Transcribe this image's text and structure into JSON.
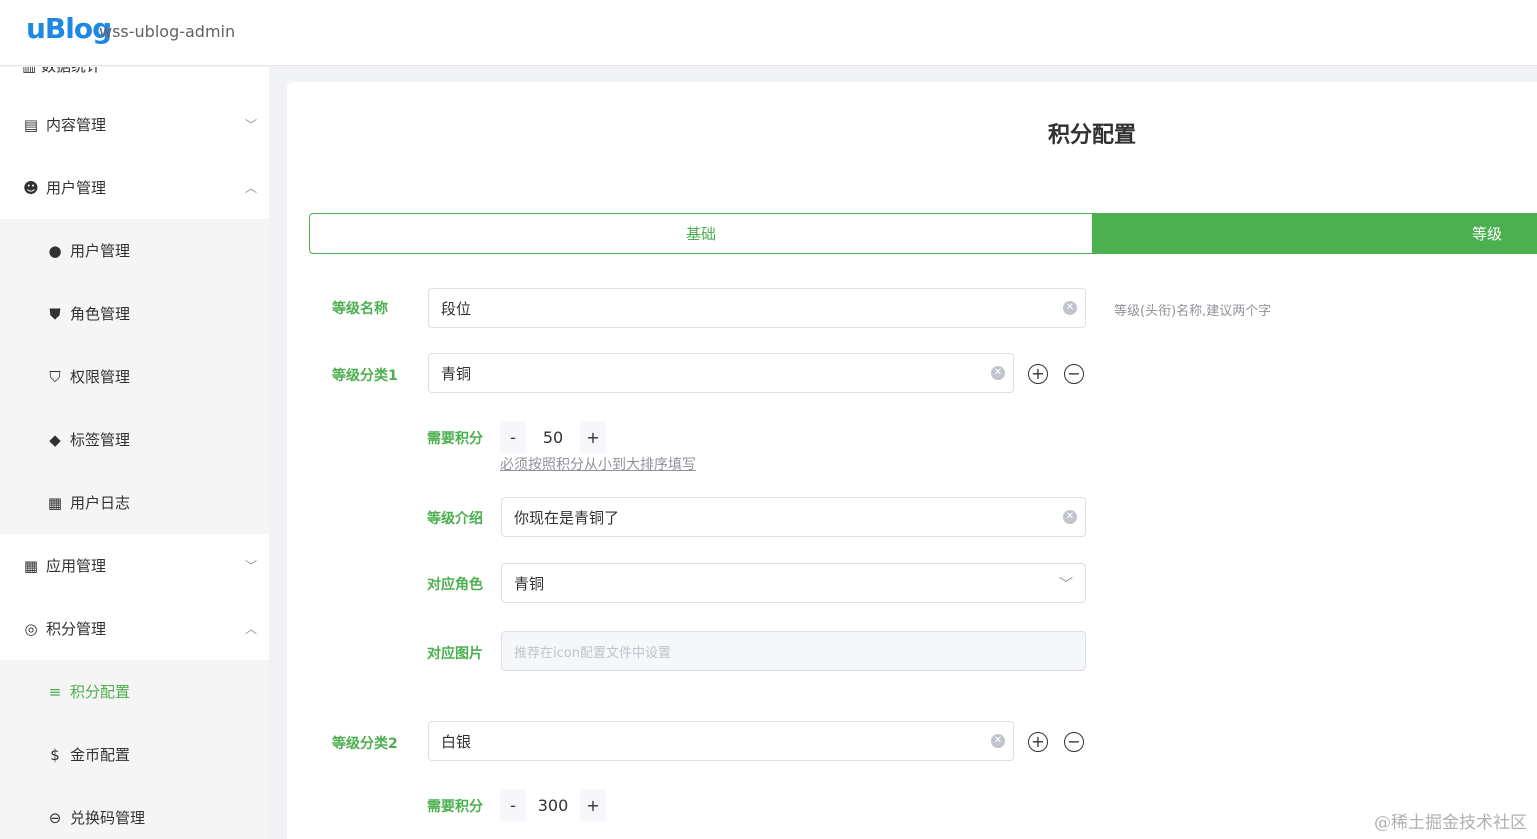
{
  "header": {
    "logo": "uBlog",
    "app_name": "wss-ublog-admin"
  },
  "sidebar": {
    "partial_top": "数据统计",
    "items": [
      {
        "label": "内容管理",
        "icon": "file-icon",
        "glyph": "▤",
        "chevron": "﹀",
        "level": "top"
      },
      {
        "label": "用户管理",
        "icon": "user-gear-icon",
        "glyph": "☻",
        "chevron": "︿",
        "level": "top"
      },
      {
        "label": "用户管理",
        "icon": "user-icon",
        "glyph": "●",
        "level": "sub"
      },
      {
        "label": "角色管理",
        "icon": "shield-user-icon",
        "glyph": "⛊",
        "level": "sub"
      },
      {
        "label": "权限管理",
        "icon": "shield-icon",
        "glyph": "⛉",
        "level": "sub"
      },
      {
        "label": "标签管理",
        "icon": "tags-icon",
        "glyph": "◆",
        "level": "sub"
      },
      {
        "label": "用户日志",
        "icon": "log-icon",
        "glyph": "▦",
        "level": "sub"
      },
      {
        "label": "应用管理",
        "icon": "apps-icon",
        "glyph": "▦",
        "chevron": "﹀",
        "level": "top"
      },
      {
        "label": "积分管理",
        "icon": "points-icon",
        "glyph": "◎",
        "chevron": "︿",
        "level": "top"
      },
      {
        "label": "积分配置",
        "icon": "database-icon",
        "glyph": "≡",
        "level": "sub",
        "active": true
      },
      {
        "label": "金币配置",
        "icon": "coin-icon",
        "glyph": "$",
        "level": "sub"
      },
      {
        "label": "兑换码管理",
        "icon": "exchange-icon",
        "glyph": "⊖",
        "level": "sub"
      }
    ]
  },
  "main": {
    "title": "积分配置",
    "tabs": [
      {
        "label": "基础"
      },
      {
        "label": "等级"
      }
    ],
    "level_name": {
      "label": "等级名称",
      "value": "段位",
      "hint": "等级(头衔)名称,建议两个字"
    },
    "categories": [
      {
        "label": "等级分类1",
        "value": "青铜",
        "points_label": "需要积分",
        "points": "50",
        "points_note": "必须按照积分从小到大排序填写",
        "intro_label": "等级介绍",
        "intro": "你现在是青铜了",
        "role_label": "对应角色",
        "role": "青铜",
        "image_label": "对应图片",
        "image_placeholder": "推荐在icon配置文件中设置"
      },
      {
        "label": "等级分类2",
        "value": "白银",
        "points_label": "需要积分",
        "points": "300"
      }
    ],
    "stepper": {
      "minus": "-",
      "plus": "+"
    }
  },
  "watermark": "@稀土掘金技术社区",
  "colors": {
    "accent": "#4caf50",
    "brand": "#1e88e5"
  }
}
